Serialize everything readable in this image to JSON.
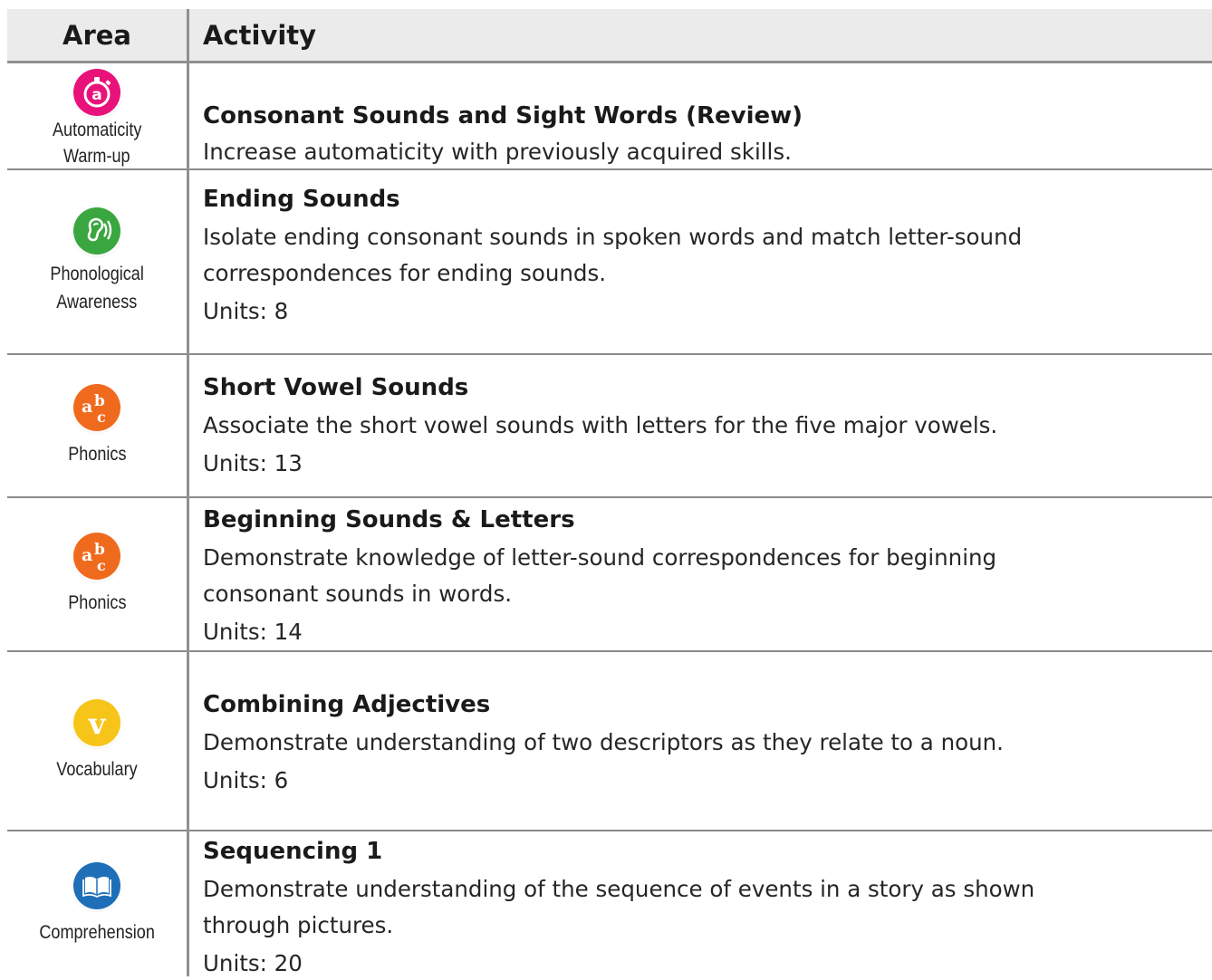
{
  "header": {
    "area": "Area",
    "activity": "Activity"
  },
  "rows": [
    {
      "area": [
        "Automaticity",
        "Warm-up"
      ],
      "icon": "automaticity-icon",
      "icon_color": "#e8127a",
      "title": "Consonant Sounds and Sight Words (Review)",
      "description": [
        "Increase automaticity with previously acquired skills."
      ],
      "units": ""
    },
    {
      "area": [
        "Phonological",
        "Awareness"
      ],
      "icon": "ear-icon",
      "icon_color": "#3aa63f",
      "title": "Ending Sounds",
      "description": [
        "Isolate ending consonant sounds in spoken words and match letter-sound",
        "correspondences for ending sounds."
      ],
      "units": "Units: 8"
    },
    {
      "area": [
        "Phonics"
      ],
      "icon": "abc-icon",
      "icon_color": "#f06a1e",
      "title": "Short Vowel Sounds",
      "description": [
        "Associate the short vowel sounds with letters for the five major vowels."
      ],
      "units": "Units: 13"
    },
    {
      "area": [
        "Phonics"
      ],
      "icon": "abc-icon",
      "icon_color": "#f06a1e",
      "title": "Beginning Sounds & Letters",
      "description": [
        "Demonstrate knowledge of letter-sound correspondences for beginning",
        "consonant sounds in words."
      ],
      "units": "Units: 14"
    },
    {
      "area": [
        "Vocabulary"
      ],
      "icon": "v-icon",
      "icon_color": "#f7c51a",
      "title": "Combining Adjectives",
      "description": [
        "Demonstrate understanding of two descriptors as they relate to a noun."
      ],
      "units": "Units: 6"
    },
    {
      "area": [
        "Comprehension"
      ],
      "icon": "book-icon",
      "icon_color": "#1f6fb8",
      "title": "Sequencing 1",
      "description": [
        "Demonstrate understanding of the sequence of events in a story as shown",
        "through pictures."
      ],
      "units": "Units: 20"
    }
  ]
}
